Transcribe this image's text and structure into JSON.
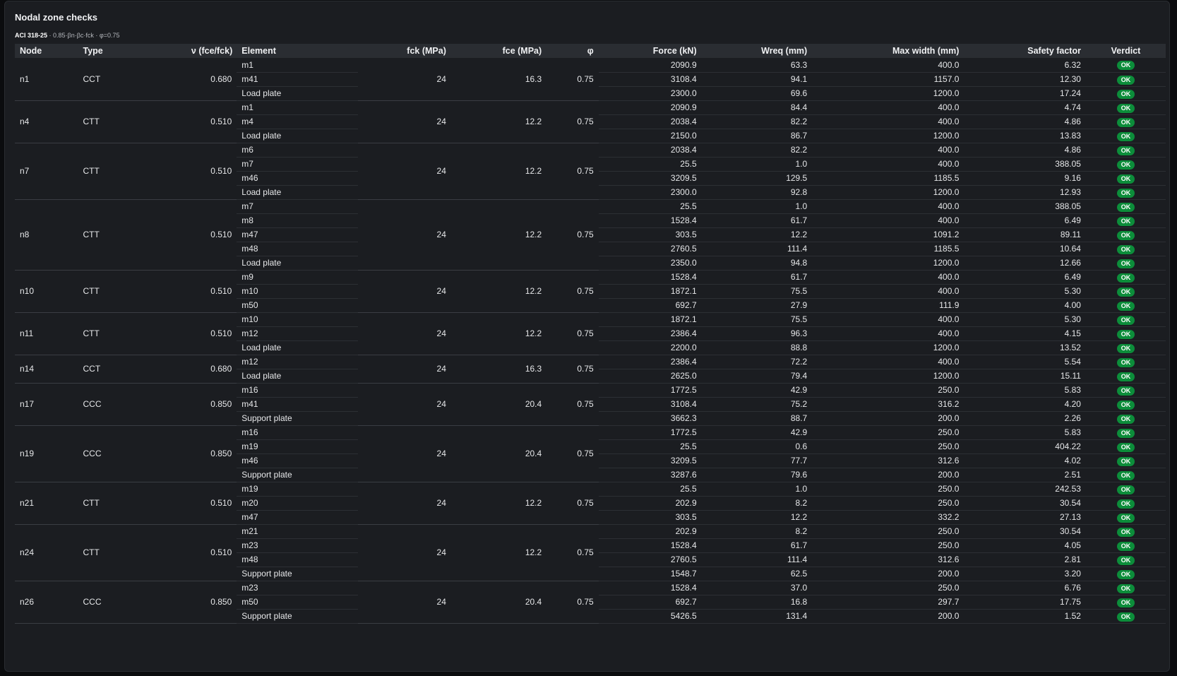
{
  "title": "Nodal zone checks",
  "subtitle_code": "ACI 318-25",
  "subtitle_rest": " · 0.85·βn·βc·fck · φ=0.75",
  "headers": [
    "Node",
    "Type",
    "ν (fce/fck)",
    "Element",
    "fck (MPa)",
    "fce (MPa)",
    "φ",
    "Force (kN)",
    "Wreq (mm)",
    "Max width (mm)",
    "Safety factor",
    "Verdict"
  ],
  "nodes": [
    {
      "node": "n1",
      "type": "CCT",
      "nu": "0.680",
      "fck": "24",
      "fce": "16.3",
      "phi": "0.75",
      "rows": [
        {
          "element": "m1",
          "force": "2090.9",
          "wreq": "63.3",
          "maxw": "400.0",
          "sf": "6.32",
          "verdict": "OK"
        },
        {
          "element": "m41",
          "force": "3108.4",
          "wreq": "94.1",
          "maxw": "1157.0",
          "sf": "12.30",
          "verdict": "OK"
        },
        {
          "element": "Load plate",
          "force": "2300.0",
          "wreq": "69.6",
          "maxw": "1200.0",
          "sf": "17.24",
          "verdict": "OK"
        }
      ]
    },
    {
      "node": "n4",
      "type": "CTT",
      "nu": "0.510",
      "fck": "24",
      "fce": "12.2",
      "phi": "0.75",
      "rows": [
        {
          "element": "m1",
          "force": "2090.9",
          "wreq": "84.4",
          "maxw": "400.0",
          "sf": "4.74",
          "verdict": "OK"
        },
        {
          "element": "m4",
          "force": "2038.4",
          "wreq": "82.2",
          "maxw": "400.0",
          "sf": "4.86",
          "verdict": "OK"
        },
        {
          "element": "Load plate",
          "force": "2150.0",
          "wreq": "86.7",
          "maxw": "1200.0",
          "sf": "13.83",
          "verdict": "OK"
        }
      ]
    },
    {
      "node": "n7",
      "type": "CTT",
      "nu": "0.510",
      "fck": "24",
      "fce": "12.2",
      "phi": "0.75",
      "rows": [
        {
          "element": "m6",
          "force": "2038.4",
          "wreq": "82.2",
          "maxw": "400.0",
          "sf": "4.86",
          "verdict": "OK"
        },
        {
          "element": "m7",
          "force": "25.5",
          "wreq": "1.0",
          "maxw": "400.0",
          "sf": "388.05",
          "verdict": "OK"
        },
        {
          "element": "m46",
          "force": "3209.5",
          "wreq": "129.5",
          "maxw": "1185.5",
          "sf": "9.16",
          "verdict": "OK"
        },
        {
          "element": "Load plate",
          "force": "2300.0",
          "wreq": "92.8",
          "maxw": "1200.0",
          "sf": "12.93",
          "verdict": "OK"
        }
      ]
    },
    {
      "node": "n8",
      "type": "CTT",
      "nu": "0.510",
      "fck": "24",
      "fce": "12.2",
      "phi": "0.75",
      "rows": [
        {
          "element": "m7",
          "force": "25.5",
          "wreq": "1.0",
          "maxw": "400.0",
          "sf": "388.05",
          "verdict": "OK"
        },
        {
          "element": "m8",
          "force": "1528.4",
          "wreq": "61.7",
          "maxw": "400.0",
          "sf": "6.49",
          "verdict": "OK"
        },
        {
          "element": "m47",
          "force": "303.5",
          "wreq": "12.2",
          "maxw": "1091.2",
          "sf": "89.11",
          "verdict": "OK"
        },
        {
          "element": "m48",
          "force": "2760.5",
          "wreq": "111.4",
          "maxw": "1185.5",
          "sf": "10.64",
          "verdict": "OK"
        },
        {
          "element": "Load plate",
          "force": "2350.0",
          "wreq": "94.8",
          "maxw": "1200.0",
          "sf": "12.66",
          "verdict": "OK"
        }
      ]
    },
    {
      "node": "n10",
      "type": "CTT",
      "nu": "0.510",
      "fck": "24",
      "fce": "12.2",
      "phi": "0.75",
      "rows": [
        {
          "element": "m9",
          "force": "1528.4",
          "wreq": "61.7",
          "maxw": "400.0",
          "sf": "6.49",
          "verdict": "OK"
        },
        {
          "element": "m10",
          "force": "1872.1",
          "wreq": "75.5",
          "maxw": "400.0",
          "sf": "5.30",
          "verdict": "OK"
        },
        {
          "element": "m50",
          "force": "692.7",
          "wreq": "27.9",
          "maxw": "111.9",
          "sf": "4.00",
          "verdict": "OK"
        }
      ]
    },
    {
      "node": "n11",
      "type": "CTT",
      "nu": "0.510",
      "fck": "24",
      "fce": "12.2",
      "phi": "0.75",
      "rows": [
        {
          "element": "m10",
          "force": "1872.1",
          "wreq": "75.5",
          "maxw": "400.0",
          "sf": "5.30",
          "verdict": "OK"
        },
        {
          "element": "m12",
          "force": "2386.4",
          "wreq": "96.3",
          "maxw": "400.0",
          "sf": "4.15",
          "verdict": "OK"
        },
        {
          "element": "Load plate",
          "force": "2200.0",
          "wreq": "88.8",
          "maxw": "1200.0",
          "sf": "13.52",
          "verdict": "OK"
        }
      ]
    },
    {
      "node": "n14",
      "type": "CCT",
      "nu": "0.680",
      "fck": "24",
      "fce": "16.3",
      "phi": "0.75",
      "rows": [
        {
          "element": "m12",
          "force": "2386.4",
          "wreq": "72.2",
          "maxw": "400.0",
          "sf": "5.54",
          "verdict": "OK"
        },
        {
          "element": "Load plate",
          "force": "2625.0",
          "wreq": "79.4",
          "maxw": "1200.0",
          "sf": "15.11",
          "verdict": "OK"
        }
      ]
    },
    {
      "node": "n17",
      "type": "CCC",
      "nu": "0.850",
      "fck": "24",
      "fce": "20.4",
      "phi": "0.75",
      "rows": [
        {
          "element": "m16",
          "force": "1772.5",
          "wreq": "42.9",
          "maxw": "250.0",
          "sf": "5.83",
          "verdict": "OK"
        },
        {
          "element": "m41",
          "force": "3108.4",
          "wreq": "75.2",
          "maxw": "316.2",
          "sf": "4.20",
          "verdict": "OK"
        },
        {
          "element": "Support plate",
          "force": "3662.3",
          "wreq": "88.7",
          "maxw": "200.0",
          "sf": "2.26",
          "verdict": "OK"
        }
      ]
    },
    {
      "node": "n19",
      "type": "CCC",
      "nu": "0.850",
      "fck": "24",
      "fce": "20.4",
      "phi": "0.75",
      "rows": [
        {
          "element": "m16",
          "force": "1772.5",
          "wreq": "42.9",
          "maxw": "250.0",
          "sf": "5.83",
          "verdict": "OK"
        },
        {
          "element": "m19",
          "force": "25.5",
          "wreq": "0.6",
          "maxw": "250.0",
          "sf": "404.22",
          "verdict": "OK"
        },
        {
          "element": "m46",
          "force": "3209.5",
          "wreq": "77.7",
          "maxw": "312.6",
          "sf": "4.02",
          "verdict": "OK"
        },
        {
          "element": "Support plate",
          "force": "3287.6",
          "wreq": "79.6",
          "maxw": "200.0",
          "sf": "2.51",
          "verdict": "OK"
        }
      ]
    },
    {
      "node": "n21",
      "type": "CTT",
      "nu": "0.510",
      "fck": "24",
      "fce": "12.2",
      "phi": "0.75",
      "rows": [
        {
          "element": "m19",
          "force": "25.5",
          "wreq": "1.0",
          "maxw": "250.0",
          "sf": "242.53",
          "verdict": "OK"
        },
        {
          "element": "m20",
          "force": "202.9",
          "wreq": "8.2",
          "maxw": "250.0",
          "sf": "30.54",
          "verdict": "OK"
        },
        {
          "element": "m47",
          "force": "303.5",
          "wreq": "12.2",
          "maxw": "332.2",
          "sf": "27.13",
          "verdict": "OK"
        }
      ]
    },
    {
      "node": "n24",
      "type": "CTT",
      "nu": "0.510",
      "fck": "24",
      "fce": "12.2",
      "phi": "0.75",
      "rows": [
        {
          "element": "m21",
          "force": "202.9",
          "wreq": "8.2",
          "maxw": "250.0",
          "sf": "30.54",
          "verdict": "OK"
        },
        {
          "element": "m23",
          "force": "1528.4",
          "wreq": "61.7",
          "maxw": "250.0",
          "sf": "4.05",
          "verdict": "OK"
        },
        {
          "element": "m48",
          "force": "2760.5",
          "wreq": "111.4",
          "maxw": "312.6",
          "sf": "2.81",
          "verdict": "OK"
        },
        {
          "element": "Support plate",
          "force": "1548.7",
          "wreq": "62.5",
          "maxw": "200.0",
          "sf": "3.20",
          "verdict": "OK"
        }
      ]
    },
    {
      "node": "n26",
      "type": "CCC",
      "nu": "0.850",
      "fck": "24",
      "fce": "20.4",
      "phi": "0.75",
      "rows": [
        {
          "element": "m23",
          "force": "1528.4",
          "wreq": "37.0",
          "maxw": "250.0",
          "sf": "6.76",
          "verdict": "OK"
        },
        {
          "element": "m50",
          "force": "692.7",
          "wreq": "16.8",
          "maxw": "297.7",
          "sf": "17.75",
          "verdict": "OK"
        },
        {
          "element": "Support plate",
          "force": "5426.5",
          "wreq": "131.4",
          "maxw": "200.0",
          "sf": "1.52",
          "verdict": "OK"
        }
      ]
    }
  ]
}
